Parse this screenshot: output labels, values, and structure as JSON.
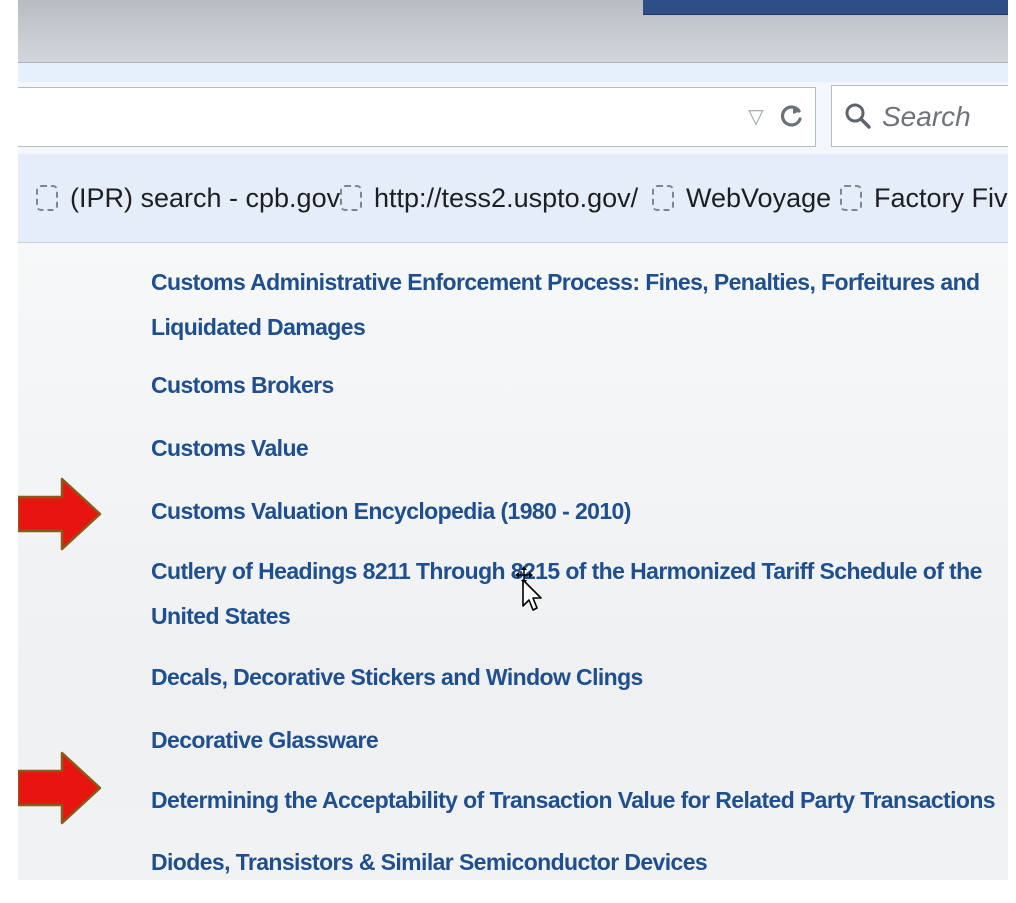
{
  "browser": {
    "search": {
      "placeholder": "Search"
    }
  },
  "bookmarks": [
    {
      "label": "(IPR) search - cpb.gov"
    },
    {
      "label": "http://tess2.uspto.gov/"
    },
    {
      "label": "WebVoyage"
    },
    {
      "label": "Factory Five"
    }
  ],
  "links": [
    {
      "lines": [
        "Customs Administrative Enforcement Process: Fines, Penalties, Forfeitures and",
        "Liquidated Damages"
      ]
    },
    {
      "lines": [
        "Customs Brokers"
      ]
    },
    {
      "lines": [
        "Customs Value"
      ]
    },
    {
      "lines": [
        "Customs Valuation Encyclopedia (1980 - 2010)"
      ],
      "marked": true
    },
    {
      "lines": [
        "Cutlery of Headings 8211 Through 8215 of the Harmonized Tariff Schedule of the",
        "United States"
      ]
    },
    {
      "lines": [
        "Decals, Decorative Stickers and Window Clings"
      ]
    },
    {
      "lines": [
        "Decorative Glassware"
      ]
    },
    {
      "lines": [
        "Determining the Acceptability of Transaction Value for Related Party Transactions"
      ],
      "marked": true
    },
    {
      "lines": [
        "Diodes, Transistors & Similar Semiconductor Devices"
      ]
    }
  ],
  "colors": {
    "link": "#1f4f8e",
    "arrow": "#e8140f",
    "arrow_outline": "#8a5a1a",
    "bookmark_bar": "#e4edf8"
  },
  "icons": {
    "dropdown": "history-dropdown-icon",
    "reload": "reload-icon",
    "search": "search-icon",
    "bookmark": "bookmark-favicon-placeholder-icon",
    "annotation": "red-arrow-icon",
    "cursor": "move-cursor-icon"
  }
}
